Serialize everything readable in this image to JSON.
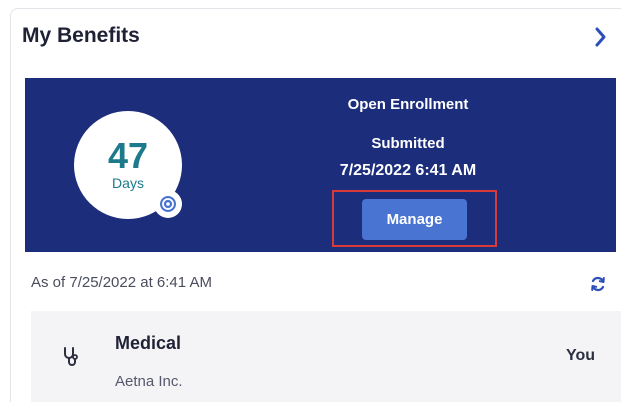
{
  "card": {
    "title": "My Benefits"
  },
  "countdown": {
    "number": "47",
    "unit": "Days"
  },
  "enrollment": {
    "title": "Open Enrollment",
    "status": "Submitted",
    "datetime": "7/25/2022 6:41 AM",
    "manage_label": "Manage"
  },
  "as_of": "As of 7/25/2022 at 6:41 AM",
  "benefits": [
    {
      "name": "Medical",
      "carrier": "Aetna Inc.",
      "coverage": "You"
    }
  ],
  "colors": {
    "banner": "#1c2d7c",
    "button": "#4a74d2",
    "accent": "#1c7a8c",
    "highlight": "#d83a3a"
  }
}
